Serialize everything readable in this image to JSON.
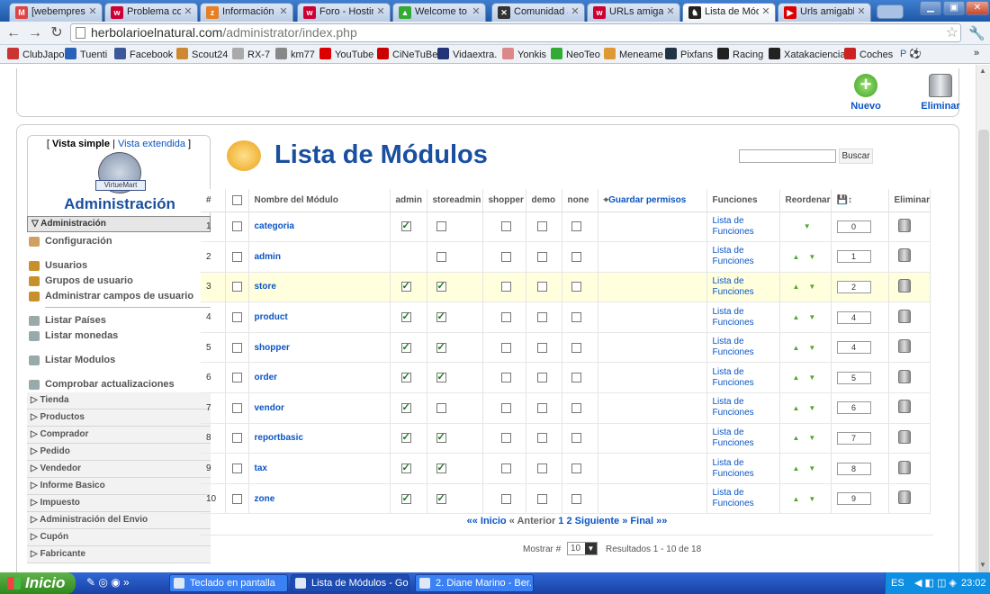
{
  "browser": {
    "tabs": [
      {
        "title": "[webempresa.jo",
        "fav": "M",
        "color": "#d44"
      },
      {
        "title": "Problema con vi",
        "fav": "w",
        "color": "#c03"
      },
      {
        "title": "Información de",
        "fav": "z",
        "color": "#e67e22"
      },
      {
        "title": "Foro - Hosting",
        "fav": "w",
        "color": "#c03"
      },
      {
        "title": "Welcome to the",
        "fav": "▲",
        "color": "#3a3"
      },
      {
        "title": "Comunidad Joo",
        "fav": "✕",
        "color": "#333"
      },
      {
        "title": "URLs amigables",
        "fav": "w",
        "color": "#c03"
      },
      {
        "title": "Lista de Módulo",
        "fav": "♞",
        "color": "#222"
      },
      {
        "title": "Urls amigables e",
        "fav": "▶",
        "color": "#d00"
      }
    ],
    "active_tab": 7,
    "url_domain": "herbolarioelnatural.com",
    "url_path": "/administrator/index.php",
    "bookmarks": [
      "ClubJapo",
      "Tuenti",
      "Facebook",
      "Scout24",
      "RX-7",
      "km77",
      "YouTube",
      "CiNeTuBe",
      "Vidaextra.",
      "Yonkis",
      "NeoTeo",
      "Meneame",
      "Pixfans",
      "Racing",
      "Xatakaciencia",
      "Coches"
    ]
  },
  "toolbar": {
    "new_label": "Nuevo",
    "delete_label": "Eliminar"
  },
  "menu": {
    "view_simple": "Vista simple",
    "view_extended": "Vista extendida",
    "logo_text": "VirtueMart",
    "title": "Administración",
    "section": "Administración",
    "items": [
      {
        "label": "Configuración"
      },
      {
        "label": "Usuarios"
      },
      {
        "label": "Grupos de usuario"
      },
      {
        "label": "Administrar campos de usuario"
      },
      {
        "label": "Listar Países"
      },
      {
        "label": "Listar monedas"
      },
      {
        "label": "Listar Modulos"
      },
      {
        "label": "Comprobar actualizaciones"
      }
    ],
    "categories": [
      "Tienda",
      "Productos",
      "Comprador",
      "Pedido",
      "Vendedor",
      "Informe Basico",
      "Impuesto",
      "Administración del Envio",
      "Cupón",
      "Fabricante"
    ]
  },
  "content": {
    "title": "Lista de Módulos",
    "search_button": "Buscar",
    "search_value": "",
    "columns": {
      "num": "#",
      "name": "Nombre del Módulo",
      "admin": "admin",
      "storeadmin": "storeadmin",
      "shopper": "shopper",
      "demo": "demo",
      "none": "none",
      "save_perms": "Guardar permisos",
      "functions": "Funciones",
      "reorder": "Reordenar",
      "delete": "Eliminar"
    },
    "functions_link": "Lista de Funciones",
    "rows": [
      {
        "num": "1",
        "name": "categoria",
        "admin": true,
        "storeadmin": false,
        "order": "0",
        "up": false,
        "down": true
      },
      {
        "num": "2",
        "name": "admin",
        "admin": null,
        "storeadmin": false,
        "order": "1",
        "up": true,
        "down": true
      },
      {
        "num": "3",
        "name": "store",
        "admin": true,
        "storeadmin": true,
        "order": "2",
        "up": true,
        "down": true
      },
      {
        "num": "4",
        "name": "product",
        "admin": true,
        "storeadmin": true,
        "order": "4",
        "up": true,
        "down": true
      },
      {
        "num": "5",
        "name": "shopper",
        "admin": true,
        "storeadmin": true,
        "order": "4",
        "up": true,
        "down": true
      },
      {
        "num": "6",
        "name": "order",
        "admin": true,
        "storeadmin": true,
        "order": "5",
        "up": true,
        "down": true
      },
      {
        "num": "7",
        "name": "vendor",
        "admin": true,
        "storeadmin": false,
        "order": "6",
        "up": true,
        "down": true
      },
      {
        "num": "8",
        "name": "reportbasic",
        "admin": true,
        "storeadmin": true,
        "order": "7",
        "up": true,
        "down": true
      },
      {
        "num": "9",
        "name": "tax",
        "admin": true,
        "storeadmin": true,
        "order": "8",
        "up": true,
        "down": true
      },
      {
        "num": "10",
        "name": "zone",
        "admin": true,
        "storeadmin": true,
        "order": "9",
        "up": true,
        "down": true
      }
    ],
    "highlight_row": 2,
    "pager": {
      "start": "«« Inicio",
      "prev": "« Anterior",
      "pages": [
        "1",
        "2"
      ],
      "next": "Siguiente »",
      "last": "Final »»"
    },
    "show_label": "Mostrar #",
    "show_value": "10",
    "results": "Resultados 1 - 10 de 18"
  },
  "taskbar": {
    "start_label": "Inicio",
    "tasks": [
      "Teclado en pantalla",
      "Lista de Módulos - Go...",
      "2. Diane Marino - Ber..."
    ],
    "active_task": 1,
    "lang": "ES",
    "clock": "23:02"
  },
  "colors": {
    "link": "#0b55c4",
    "title": "#1a4fa0",
    "highlight": "#ffffdd",
    "check": "#1b7a1b"
  }
}
